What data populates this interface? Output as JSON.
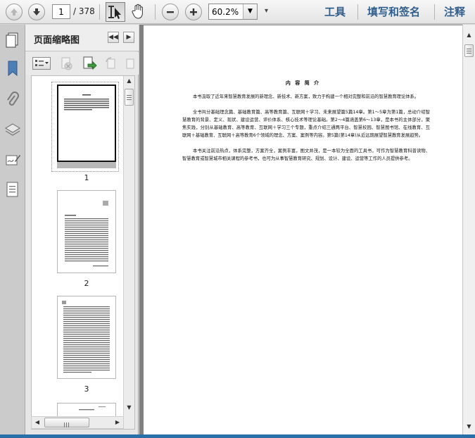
{
  "toolbar": {
    "current_page": "1",
    "total_pages": "/ 378",
    "zoom": "60.2%",
    "more": "▾",
    "tools_label": "工具",
    "sign_label": "填写和签名",
    "comment_label": "注释"
  },
  "panel": {
    "title": "页面缩略图",
    "thumbs": [
      {
        "label": "1"
      },
      {
        "label": "2"
      },
      {
        "label": "3"
      }
    ]
  },
  "document": {
    "heading": "内 容 简 介",
    "paragraphs": [
      "本书汲取了近年来智慧教育发展的新理念、新技术、新方案，致力于构建一个相对完整和前沿的智慧教育理论体系。",
      "全书共分基础理念篇、基础教育篇、高等教育篇、互联网＋学习、未来展望篇5篇14章。第1～5章为第1篇，总动介绍智慧教育的背景、定义、现状、建设运营、评价体系、核心技术等理论基础。第2～4篇涵盖第6～13章，是本书的主体部分，聚焦实践，分别从基础教育、高等教育、互联网＋学习三个专题，重点介绍三通两平台、智慧校园、智慧图书馆、在线教育、互联网＋基础教育、互联网＋高等教育6个领域的理念、方案、案例等内容。第5篇(第14章)从近远期展望智慧教育发展趋势。",
      "本书关注前沿热点，体系完整，方案齐全，案例丰富，图文并茂，是一本较为全面的工具书，可作为智慧教育科普读物、智慧教育或智慧城市相关课程的参考书，也可为从事智慧教育研究、规划、设计、建设、运营等工作的人员提供参考。"
    ]
  },
  "colors": {
    "accent": "#2f5e8c",
    "doc_bg": "#808080",
    "status_bar": "#2a6fa8"
  }
}
